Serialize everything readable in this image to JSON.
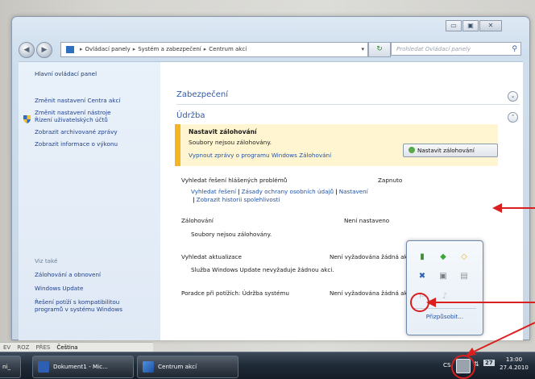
{
  "window": {
    "controls": [
      "▭",
      "▣",
      "✕"
    ],
    "breadcrumb": [
      "Ovládací panely",
      "Systém a zabezpečení",
      "Centrum akcí"
    ],
    "search_placeholder": "Prohledat Ovládací panely"
  },
  "sidebar": {
    "home": "Hlavní ovládací panel",
    "items": [
      "Změnit nastavení Centra akcí",
      "Změnit nastavení nástroje",
      "Řízení uživatelských účtů",
      "Zobrazit archivované zprávy",
      "Zobrazit informace o výkonu"
    ],
    "see_also_title": "Viz také",
    "see_also": [
      "Zálohování a obnovení",
      "Windows Update",
      "Řešení potíží s kompatibilitou",
      "programů v systému Windows"
    ]
  },
  "main": {
    "security_title": "Zabezpečení",
    "maintenance_title": "Údržba",
    "alert": {
      "title": "Nastavit zálohování",
      "desc": "Soubory nejsou zálohovány.",
      "link": "Vypnout zprávy o programu Windows Zálohování",
      "button": "Nastavit zálohování"
    },
    "problems": {
      "label": "Vyhledat řešení hlášených problémů",
      "status": "Zapnuto",
      "links": [
        "Vyhledat řešení",
        "Zásady ochrany osobních údajů",
        "Nastavení"
      ],
      "history": "Zobrazit historii spolehlivosti"
    },
    "backup": {
      "label": "Zálohování",
      "status": "Není nastaveno",
      "desc": "Soubory nejsou zálohovány."
    },
    "updates": {
      "label": "Vyhledat aktualizace",
      "status": "Není vyžadována žádná akce",
      "desc": "Služba Windows Update nevyžaduje žádnou akci."
    },
    "troubleshoot": {
      "label": "Poradce při potížích: Údržba systému",
      "status": "Není vyžadována žádná akce"
    }
  },
  "tray_popup": {
    "customize": "Přizpůsobit..."
  },
  "langbar": {
    "items": [
      "EV",
      "ROZ",
      "PŘES",
      "Čeština"
    ]
  },
  "taskbar": {
    "items": [
      "ni_",
      "Dokument1 - Mic...",
      "Centrum akcí"
    ],
    "lang": "CS",
    "time": "13:00",
    "date": "27.4.2010",
    "badge": "27"
  },
  "colors": {
    "accent": "#2053a8",
    "alert_stripe": "#f2b625",
    "annotation": "#d9201f"
  }
}
